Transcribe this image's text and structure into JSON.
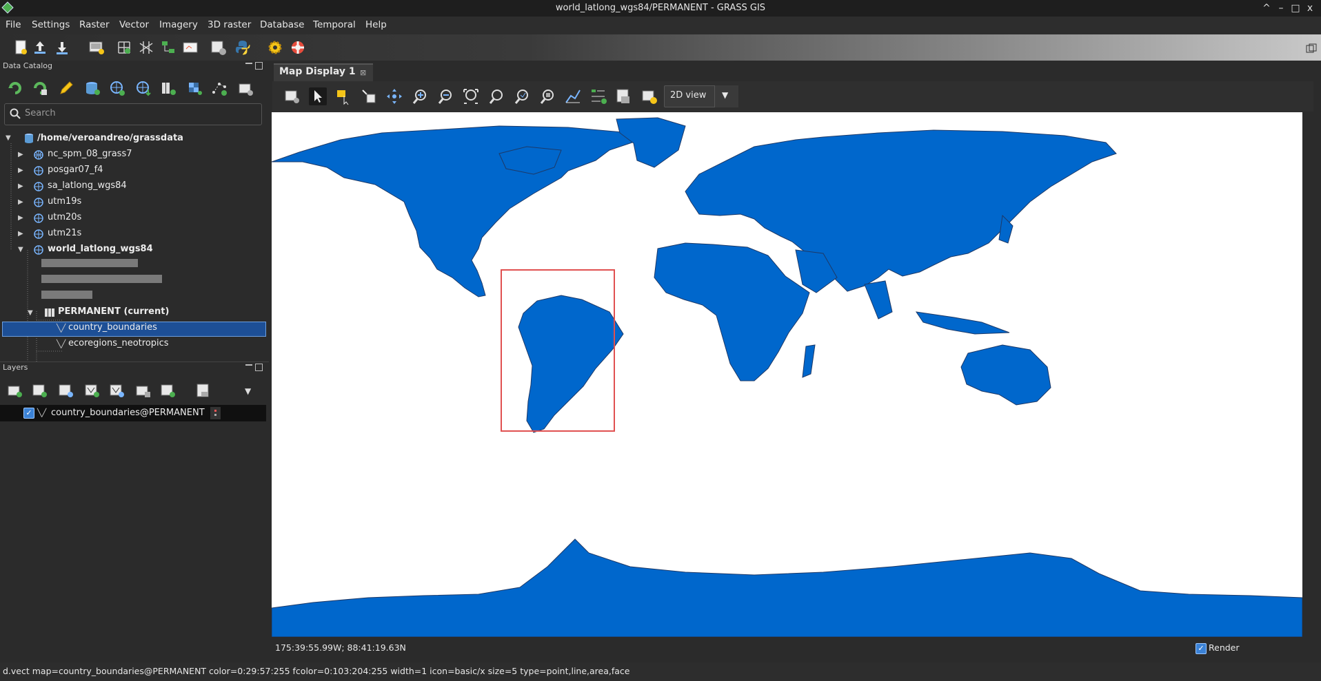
{
  "window": {
    "title": "world_latlong_wgs84/PERMANENT - GRASS GIS",
    "controls": [
      "^",
      "–",
      "□",
      "x"
    ]
  },
  "menu": [
    "File",
    "Settings",
    "Raster",
    "Vector",
    "Imagery",
    "3D raster",
    "Database",
    "Temporal",
    "Help"
  ],
  "data_catalog": {
    "title": "Data Catalog",
    "search_placeholder": "Search",
    "root": "/home/veroandreo/grassdata",
    "locations": [
      "nc_spm_08_grass7",
      "posgar07_f4",
      "sa_latlong_wgs84",
      "utm19s",
      "utm20s",
      "utm21s",
      "world_latlong_wgs84"
    ],
    "mapset": "PERMANENT  (current)",
    "maps": [
      "country_boundaries",
      "ecoregions_neotropics"
    ],
    "selected_map": "country_boundaries"
  },
  "layers": {
    "title": "Layers",
    "items": [
      {
        "name": "country_boundaries@PERMANENT",
        "checked": true
      }
    ]
  },
  "map_display": {
    "tab_label": "Map Display 1",
    "view_mode": "2D view",
    "coordinates": "175:39:55.99W; 88:41:19.63N",
    "render_label": "Render",
    "render_checked": true,
    "fill_color": "#0067cc",
    "border_color": "#1d3967",
    "highlight_color": "#e05050"
  },
  "statusbar": {
    "command": "d.vect map=country_boundaries@PERMANENT color=0:29:57:255 fcolor=0:103:204:255 width=1 icon=basic/x size=5 type=point,line,area,face"
  }
}
